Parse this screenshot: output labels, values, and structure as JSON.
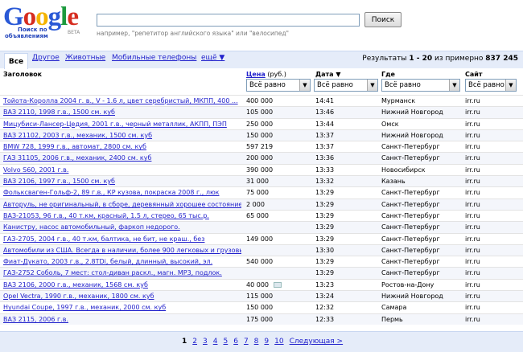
{
  "logo": {
    "letters": [
      {
        "ch": "G",
        "color": "#2a59d6"
      },
      {
        "ch": "o",
        "color": "#d62d20"
      },
      {
        "ch": "o",
        "color": "#f4b400"
      },
      {
        "ch": "g",
        "color": "#2a59d6"
      },
      {
        "ch": "l",
        "color": "#1c9a3e"
      },
      {
        "ch": "e",
        "color": "#d62d20"
      }
    ],
    "line1": "Поиск по",
    "line2": "объявлениям",
    "beta": "BETA"
  },
  "search": {
    "value": "",
    "button": "Поиск",
    "hint": "например, \"репетитор английского языка\" или \"велосипед\""
  },
  "tabs": {
    "active": "Все",
    "others": [
      "Другое",
      "Животные",
      "Мобильные телефоны",
      "ещё ▼"
    ]
  },
  "results": {
    "prefix": "Результаты ",
    "range": "1 - 20",
    "middle": " из примерно ",
    "total": "837 245"
  },
  "columns": {
    "title": "Заголовок",
    "price_link": "Цена",
    "price_unit": " (руб.)",
    "date": "Дата ▼",
    "place": "Где",
    "site": "Сайт"
  },
  "filters": {
    "price": "Всё равно",
    "date": "Всё равно",
    "place": "Всё равно",
    "site": "Всё равно"
  },
  "rows": [
    {
      "title": "Тойота-Королла 2004 г. в., V - 1.6 л, цвет серебристый, МКПП, 400 ...",
      "price": "400 000",
      "time": "14:41",
      "place": "Мурманск",
      "site": "irr.ru"
    },
    {
      "title": "ВАЗ 2110, 1998 г.в., 1500 см. куб",
      "price": "105 000",
      "time": "13:46",
      "place": "Нижний Новгород",
      "site": "irr.ru"
    },
    {
      "title": "Мицубиси-Лансер-Цедия, 2001 г.в., черный металлик, АКПП, ПЭП",
      "price": "250 000",
      "time": "13:44",
      "place": "Омск",
      "site": "irr.ru"
    },
    {
      "title": "ВАЗ 21102, 2003 г.в., механик, 1500 см. куб",
      "price": "150 000",
      "time": "13:37",
      "place": "Нижний Новгород",
      "site": "irr.ru"
    },
    {
      "title": "BMW 728, 1999 г.в., автомат, 2800 см. куб",
      "price": "597 219",
      "time": "13:37",
      "place": "Санкт-Петербург",
      "site": "irr.ru"
    },
    {
      "title": "ГАЗ 31105, 2006 г.в., механик, 2400 см. куб",
      "price": "200 000",
      "time": "13:36",
      "place": "Санкт-Петербург",
      "site": "irr.ru"
    },
    {
      "title": "Volvo S60, 2001 г.в.",
      "price": "390 000",
      "time": "13:33",
      "place": "Новосибирск",
      "site": "irr.ru"
    },
    {
      "title": "ВАЗ 2106, 1997 г.в., 1500 см. куб",
      "price": "31 000",
      "time": "13:32",
      "place": "Казань",
      "site": "irr.ru"
    },
    {
      "title": "Фольксваген-Гольф-2, 89 г.в., КР кузова, покраска 2008 г., люк",
      "price": "75 000",
      "time": "13:29",
      "place": "Санкт-Петербург",
      "site": "irr.ru"
    },
    {
      "title": "Авторуль, не оригинальный, в сборе, деревянный хорошее состояние",
      "price": "2 000",
      "time": "13:29",
      "place": "Санкт-Петербург",
      "site": "irr.ru"
    },
    {
      "title": "ВАЗ-21053, 96 г.в., 40 т.км, красный, 1.5 л, стерео, 65 тыс.р.",
      "price": "65 000",
      "time": "13:29",
      "place": "Санкт-Петербург",
      "site": "irr.ru"
    },
    {
      "title": "Канистру, насос автомобильный, фаркоп недорого.",
      "price": "",
      "time": "13:29",
      "place": "Санкт-Петербург",
      "site": "irr.ru"
    },
    {
      "title": "ГАЗ-2705, 2004 г.в., 40 т.км, балтика, не бит, не краш., без",
      "price": "149 000",
      "time": "13:29",
      "place": "Санкт-Петербург",
      "site": "irr.ru"
    },
    {
      "title": "Автомобили из США. Всегда в наличии, более 900 легковых и грузовых ...",
      "price": "",
      "time": "13:30",
      "place": "Санкт-Петербург",
      "site": "irr.ru"
    },
    {
      "title": "Фиат-Дукато, 2003 г.в., 2.8TDi, белый, длинный, высокий, эл.",
      "price": "540 000",
      "time": "13:29",
      "place": "Санкт-Петербург",
      "site": "irr.ru"
    },
    {
      "title": "ГАЗ-2752 Соболь, 7 мест: стол-диван раскл., магн. MP3, подлок.",
      "price": "",
      "time": "13:29",
      "place": "Санкт-Петербург",
      "site": "irr.ru"
    },
    {
      "title": "ВАЗ 2106, 2000 г.в., механик, 1568 см. куб",
      "price": "40 000",
      "time": "13:23",
      "place": "Ростов-на-Дону",
      "site": "irr.ru",
      "has_image": true
    },
    {
      "title": "Opel Vectra, 1990 г.в., механик, 1800 см. куб",
      "price": "115 000",
      "time": "13:24",
      "place": "Нижний Новгород",
      "site": "irr.ru"
    },
    {
      "title": "Hyundai Coupe, 1997 г.в., механик, 2000 см. куб",
      "price": "150 000",
      "time": "12:32",
      "place": "Самара",
      "site": "irr.ru"
    },
    {
      "title": "ВАЗ 2115, 2006 г.в.",
      "price": "175 000",
      "time": "12:33",
      "place": "Пермь",
      "site": "irr.ru"
    }
  ],
  "pager": {
    "current": "1",
    "pages": [
      "2",
      "3",
      "4",
      "5",
      "6",
      "7",
      "8",
      "9",
      "10"
    ],
    "next": "Следующая >"
  }
}
